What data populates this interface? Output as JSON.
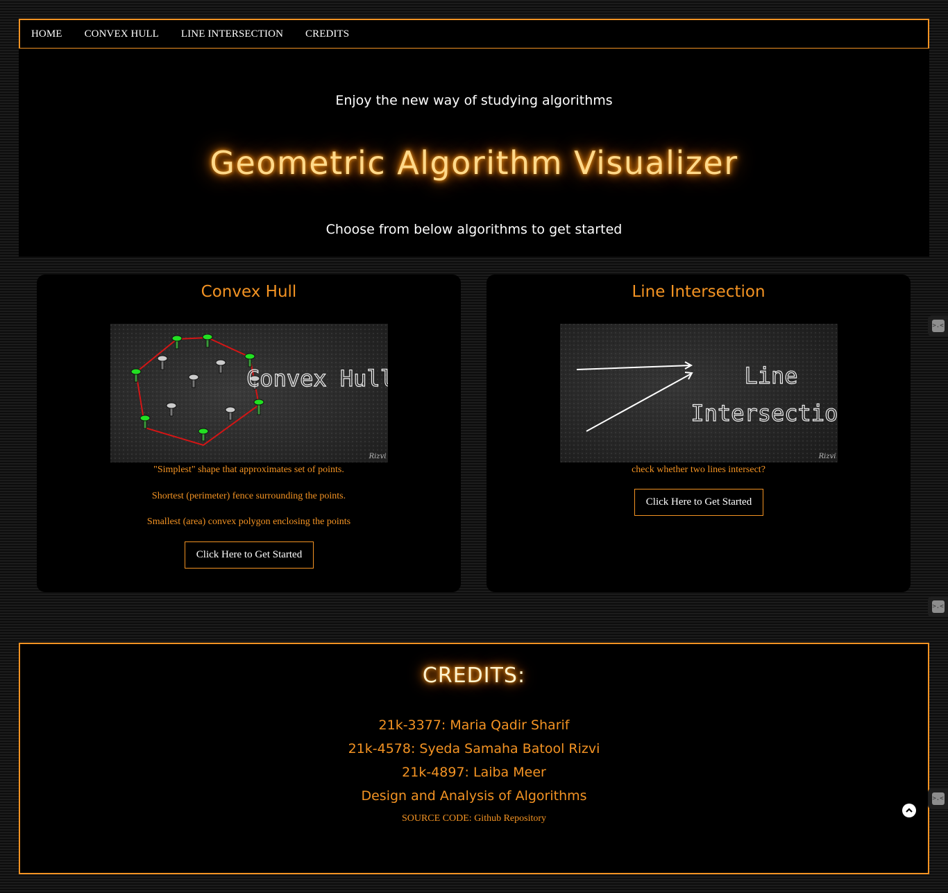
{
  "nav": {
    "items": [
      "HOME",
      "CONVEX HULL",
      "LINE INTERSECTION",
      "CREDITS"
    ]
  },
  "hero": {
    "tagline": "Enjoy the new way of studying algorithms",
    "title": "Geometric Algorithm Visualizer",
    "subtitle": "Choose from below algorithms to get started"
  },
  "cards": [
    {
      "title": "Convex Hull",
      "image_text": "Convex Hull",
      "image_signature": "Rizvi",
      "descriptions": [
        "\"Simplest\" shape that approximates set of points.",
        "Shortest (perimeter) fence surrounding the points.",
        "Smallest (area) convex polygon enclosing the points"
      ],
      "button": "Click Here to Get Started"
    },
    {
      "title": "Line Intersection",
      "image_text_1": "Line",
      "image_text_2": "Intersection",
      "image_signature": "Rizvi",
      "descriptions": [
        "check whether two lines intersect?"
      ],
      "button": "Click Here to Get Started"
    }
  ],
  "credits": {
    "heading": "CREDITS:",
    "lines": [
      "21k-3377: Maria Qadir Sharif",
      "21k-4578: Syeda Samaha Batool Rizvi",
      "21k-4897: Laiba Meer",
      "Design and Analysis of Algorithms"
    ],
    "source": "SOURCE CODE: Github Repository"
  },
  "colors": {
    "accent": "#f39323",
    "glow": "#ffd98a",
    "background": "#000000"
  },
  "icons": {
    "scroll_top": "chevron-up-icon",
    "side_widget": "sprite-widget-icon"
  }
}
